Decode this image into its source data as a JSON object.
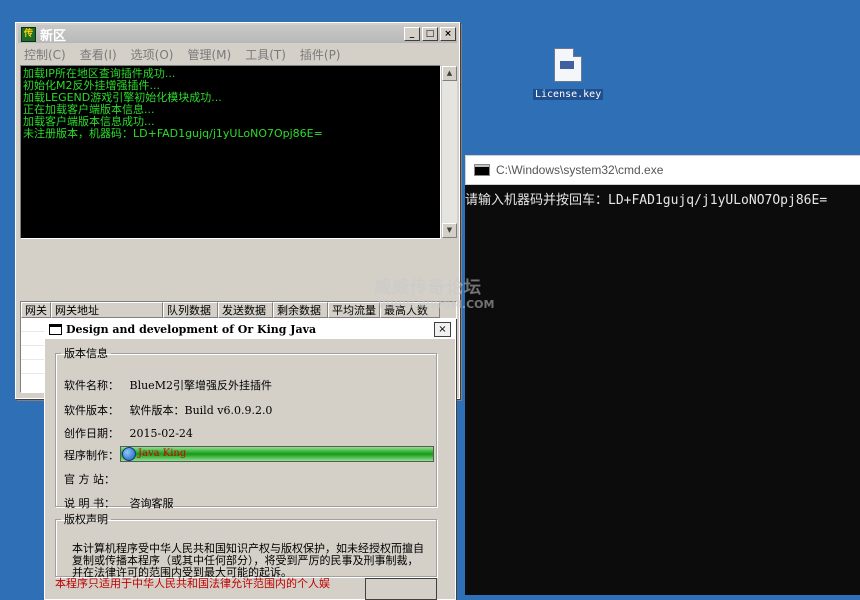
{
  "main_window": {
    "title": "新区",
    "app_icon": "传",
    "title_buttons": [
      "_",
      "□",
      "×"
    ],
    "menu": [
      "控制(C)",
      "查看(I)",
      "选项(O)",
      "管理(M)",
      "工具(T)",
      "插件(P)"
    ],
    "log_lines": [
      "加载IP所在地区查询插件成功...",
      "初始化M2反外挂增强插件...",
      "加载LEGEND游戏引擎初始化模块成功...",
      "正在加载客户端版本信息...",
      "加载客户端版本信息成功...",
      "未注册版本，机器码：LD+FAD1gujq/j1yULoNO7Opj86E="
    ],
    "gateway_columns": [
      "网关",
      "网关地址",
      "队列数据",
      "发送数据",
      "剩余数据",
      "平均流量",
      "最高人数"
    ]
  },
  "desktop": {
    "license_icon_label": "License.key"
  },
  "cmd_window": {
    "title": "C:\\Windows\\system32\\cmd.exe",
    "output": "请输入机器码并按回车：LD+FAD1gujq/j1yULoNO7Opj86E="
  },
  "watermark": {
    "line1": "威威传奇论坛",
    "line2": "WWW.WWGM.COM"
  },
  "about_dialog": {
    "title": "Design and development of Or King Java",
    "close_label": "×",
    "version_group": "版本信息",
    "software_name_label": "软件名称：",
    "software_name": "BlueM2引擎增强反外挂插件",
    "software_version_label": "软件版本：",
    "software_version": "软件版本：Build  v6.0.9.2.0",
    "created_label": "创作日期：",
    "created_date": "2015-02-24",
    "author_label": "程序制作：",
    "author": "Java King",
    "website_label": "官 方 站：",
    "website": "",
    "manual_label": "说 明 书：",
    "manual": "咨询客服",
    "copyright_group": "版权声明",
    "copyright_text": "本计算机程序受中华人民共和国知识产权与版权保护，如未经授权而擅自复制或传播本程序（或其中任何部分），将受到严厉的民事及刑事制裁，并在法律许可的范围内受到最大可能的起诉。",
    "warning_text": "本程序只适用于中华人民共和国法律允许范围内的个人娱"
  }
}
